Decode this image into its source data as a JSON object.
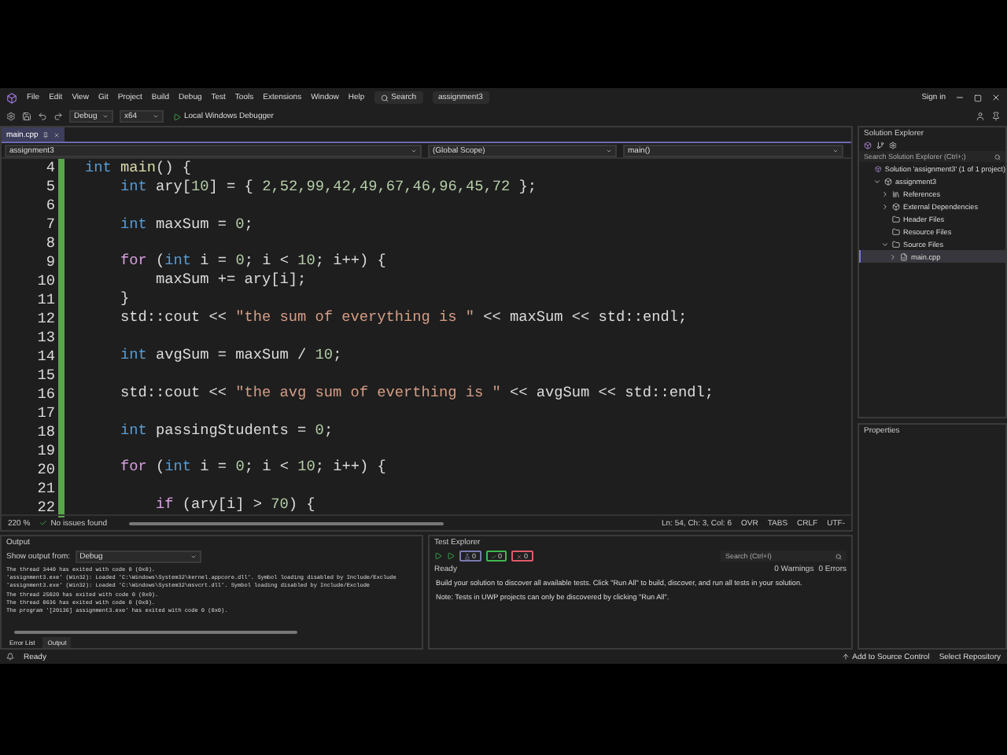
{
  "menu": {
    "items": [
      "File",
      "Edit",
      "View",
      "Git",
      "Project",
      "Build",
      "Debug",
      "Test",
      "Tools",
      "Extensions",
      "Window",
      "Help"
    ],
    "search": "Search",
    "solution_name": "assignment3",
    "sign_in": "Sign in"
  },
  "toolbar": {
    "configuration": "Debug",
    "platform": "x64",
    "run": "Local Windows Debugger"
  },
  "editor": {
    "tabs": [
      {
        "label": "main.cpp",
        "selected": true
      }
    ],
    "nav": {
      "project": "assignment3",
      "scope": "(Global Scope)",
      "member": "main()"
    },
    "lines": [
      {
        "n": "4",
        "tokens": [
          {
            "kind": "keyword",
            "text": "int"
          },
          {
            "kind": "function",
            "text": " main"
          },
          {
            "kind": "plain",
            "text": "() {"
          }
        ]
      },
      {
        "n": "5",
        "tokens": [
          {
            "kind": "keyword",
            "text": "    int"
          },
          {
            "kind": "plain",
            "text": " ary["
          },
          {
            "kind": "number",
            "text": "10"
          },
          {
            "kind": "plain",
            "text": "] = { "
          },
          {
            "kind": "number",
            "text": "2,52,99,42,49,67,46,96,45,72"
          },
          {
            "kind": "plain",
            "text": " };"
          }
        ]
      },
      {
        "n": "6"
      },
      {
        "n": "7",
        "tokens": [
          {
            "kind": "keyword",
            "text": "    int"
          },
          {
            "kind": "plain",
            "text": " maxSum = "
          },
          {
            "kind": "number",
            "text": "0"
          },
          {
            "kind": "plain",
            "text": ";"
          }
        ]
      },
      {
        "n": "8"
      },
      {
        "n": "9",
        "tokens": [
          {
            "kind": "control",
            "text": "    for"
          },
          {
            "kind": "plain",
            "text": " ("
          },
          {
            "kind": "keyword",
            "text": "int"
          },
          {
            "kind": "plain",
            "text": " i = "
          },
          {
            "kind": "number",
            "text": "0"
          },
          {
            "kind": "plain",
            "text": "; i < "
          },
          {
            "kind": "number",
            "text": "10"
          },
          {
            "kind": "plain",
            "text": "; i++) {"
          }
        ]
      },
      {
        "n": "10",
        "tokens": [
          {
            "kind": "plain",
            "text": "        maxSum += ary[i];"
          }
        ]
      },
      {
        "n": "11",
        "tokens": [
          {
            "kind": "plain",
            "text": "    }"
          }
        ]
      },
      {
        "n": "12",
        "tokens": [
          {
            "kind": "plain",
            "text": "    std::cout << "
          },
          {
            "kind": "string",
            "text": "\"the sum of everything is \""
          },
          {
            "kind": "plain",
            "text": " << maxSum << std::endl;"
          }
        ]
      },
      {
        "n": "13"
      },
      {
        "n": "14",
        "tokens": [
          {
            "kind": "keyword",
            "text": "    int"
          },
          {
            "kind": "plain",
            "text": " avgSum = maxSum / "
          },
          {
            "kind": "number",
            "text": "10"
          },
          {
            "kind": "plain",
            "text": ";"
          }
        ]
      },
      {
        "n": "15"
      },
      {
        "n": "16",
        "tokens": [
          {
            "kind": "plain",
            "text": "    std::cout << "
          },
          {
            "kind": "string",
            "text": "\"the avg sum of everthing is \""
          },
          {
            "kind": "plain",
            "text": " << avgSum << std::endl;"
          }
        ]
      },
      {
        "n": "17"
      },
      {
        "n": "18",
        "tokens": [
          {
            "kind": "keyword",
            "text": "    int"
          },
          {
            "kind": "plain",
            "text": " passingStudents = "
          },
          {
            "kind": "number",
            "text": "0"
          },
          {
            "kind": "plain",
            "text": ";"
          }
        ]
      },
      {
        "n": "19"
      },
      {
        "n": "20",
        "tokens": [
          {
            "kind": "control",
            "text": "    for"
          },
          {
            "kind": "plain",
            "text": " ("
          },
          {
            "kind": "keyword",
            "text": "int"
          },
          {
            "kind": "plain",
            "text": " i = "
          },
          {
            "kind": "number",
            "text": "0"
          },
          {
            "kind": "plain",
            "text": "; i < "
          },
          {
            "kind": "number",
            "text": "10"
          },
          {
            "kind": "plain",
            "text": "; i++) {"
          }
        ]
      },
      {
        "n": "21"
      },
      {
        "n": "22",
        "tokens": [
          {
            "kind": "control",
            "text": "        if"
          },
          {
            "kind": "plain",
            "text": " (ary[i] > "
          },
          {
            "kind": "number",
            "text": "70"
          },
          {
            "kind": "plain",
            "text": ") {"
          }
        ]
      }
    ],
    "status": {
      "zoom": "220 %",
      "issues": "No issues found",
      "position": "Ln: 54, Ch: 3, Col: 6",
      "mode": "OVR",
      "indent": "TABS",
      "eol": "CRLF",
      "encoding": "UTF-"
    }
  },
  "output": {
    "title": "Output",
    "show_from_label": "Show output from:",
    "source": "Debug",
    "lines": [
      "The thread 3440 has exited with code 0 (0x0).",
      "'assignment3.exe' (Win32): Loaded 'C:\\Windows\\System32\\kernel.appcore.dll'. Symbol loading disabled by Include/Exclude",
      "'assignment3.exe' (Win32): Loaded 'C:\\Windows\\System32\\msvcrt.dll'. Symbol loading disabled by Include/Exclude",
      "The thread 25020 has exited with code 0 (0x0).",
      "The thread 8636 has exited with code 0 (0x0).",
      "The program '[20136] assignment3.exe' has exited with code 0 (0x0)."
    ],
    "tabs": [
      {
        "label": "Error List",
        "selected": false
      },
      {
        "label": "Output",
        "selected": true
      }
    ]
  },
  "test_explorer": {
    "title": "Test Explorer",
    "counters": [
      {
        "kind": "total",
        "count": "0"
      },
      {
        "kind": "passed",
        "count": "0"
      },
      {
        "kind": "failed",
        "count": "0"
      }
    ],
    "search": {
      "placeholder": "Search (Ctrl+I)"
    },
    "state": "Ready",
    "warnings": "0 Warnings",
    "errors": "0 Errors",
    "messages": [
      "Build your solution to discover all available tests. Click \"Run All\" to build, discover, and run all tests in your solution.",
      "Note: Tests in UWP projects can only be discovered by clicking \"Run All\"."
    ]
  },
  "solution_explorer": {
    "title": "Solution Explorer",
    "search": {
      "placeholder": "Search Solution Explorer (Ctrl+;)"
    },
    "tree": [
      {
        "label": "Solution 'assignment3' (1 of 1 project)",
        "kind": "solution",
        "selected": false,
        "children": [
          {
            "label": "assignment3",
            "kind": "project",
            "expanded": true,
            "selected": false,
            "children": [
              {
                "label": "References",
                "kind": "references",
                "expanded": false,
                "selected": false
              },
              {
                "label": "External Dependencies",
                "kind": "dependencies",
                "expanded": false,
                "selected": false
              },
              {
                "label": "Header Files",
                "kind": "folder",
                "selected": false
              },
              {
                "label": "Resource Files",
                "kind": "folder",
                "selected": false
              },
              {
                "label": "Source Files",
                "kind": "folder",
                "expanded": true,
                "selected": false,
                "children": [
                  {
                    "label": "main.cpp",
                    "kind": "file",
                    "expanded": false,
                    "selected": true
                  }
                ]
              }
            ]
          }
        ]
      }
    ]
  },
  "properties": {
    "title": "Properties"
  },
  "status_bar": {
    "state": "Ready",
    "source_control": "Add to Source Control",
    "repository": "Select Repository"
  }
}
